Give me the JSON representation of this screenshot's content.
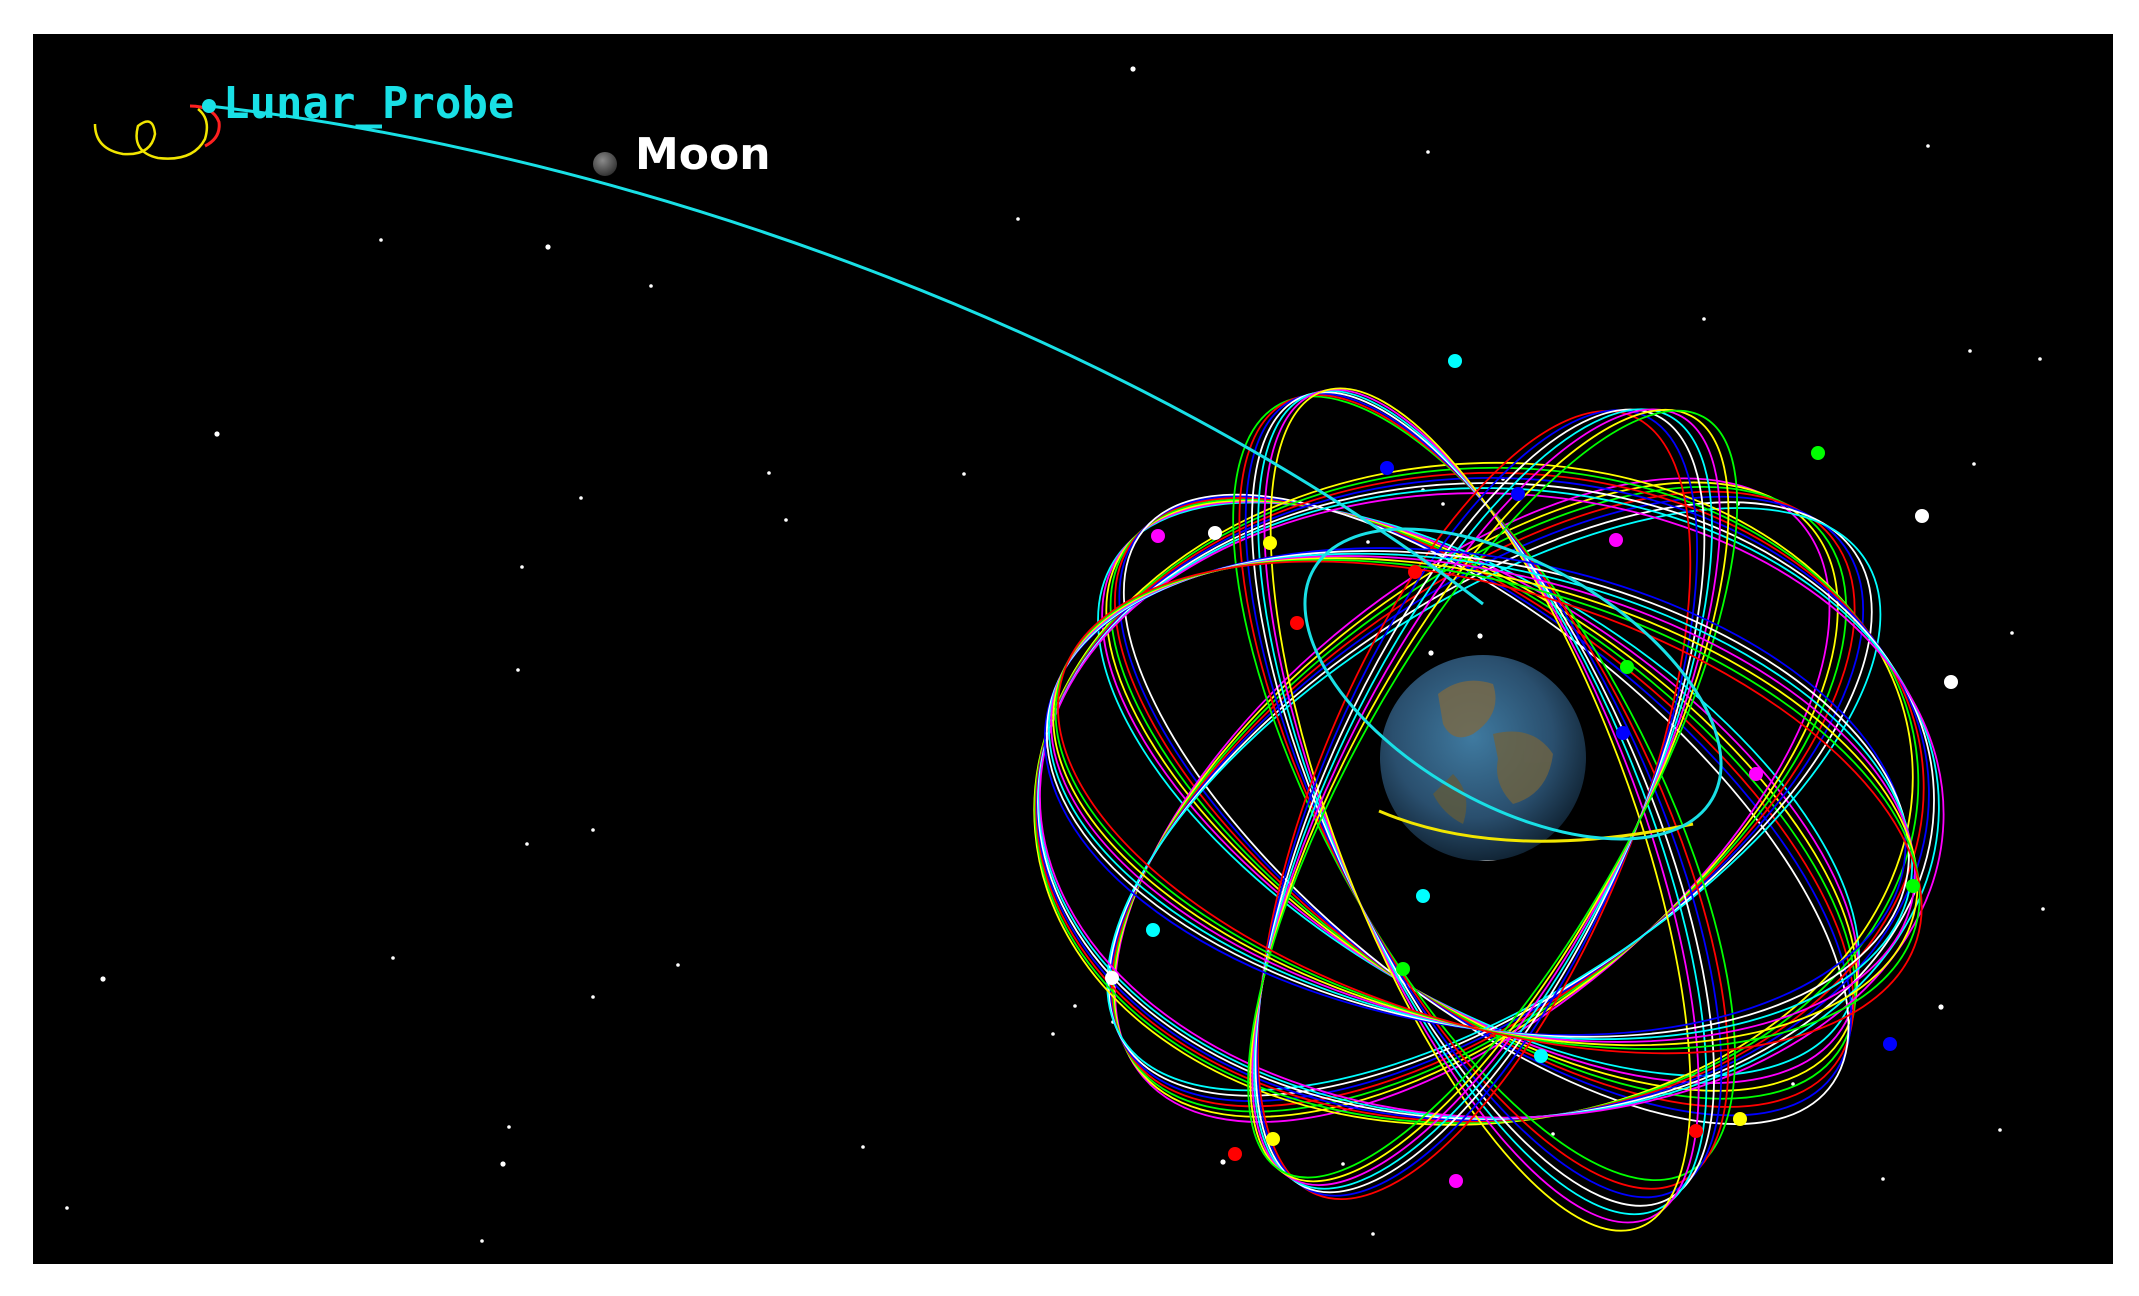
{
  "labels": {
    "probe": "Lunar_Probe",
    "moon": "Moon"
  },
  "colors": {
    "background": "#000000",
    "page": "#ffffff",
    "probe_trajectory": "#19e0e6",
    "probe_label": "#19e0e6",
    "moon_label": "#ffffff",
    "lunar_orbit_loops": "#f2e600",
    "probe_burn_arc": "#ff2020",
    "moon_body": "#5a5a5a",
    "earth_ocean": "#2e5a7c",
    "earth_land": "#8a7a52",
    "earth_equator_ring": "#f2e600",
    "stars": "#ffffff",
    "constellation_orbit_palette": [
      "#00ffff",
      "#ff00ff",
      "#ffff00",
      "#00ff00",
      "#ff0000",
      "#0000ff",
      "#ffffff"
    ]
  },
  "icons": {
    "moon": "moon-icon",
    "earth": "earth-icon",
    "probe": "probe-marker-icon"
  }
}
